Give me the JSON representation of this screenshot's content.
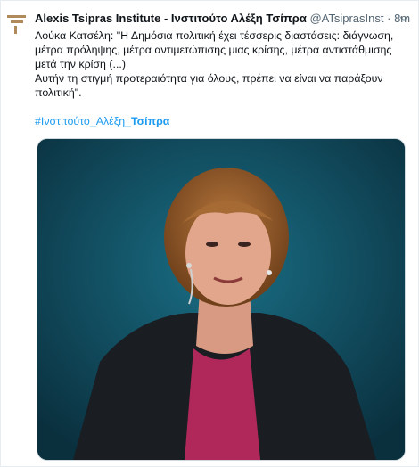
{
  "tweet": {
    "display_name": "Alexis Tsipras Institute - Ινστιτούτο Αλέξη Τσίπρα",
    "handle": "@ATsiprasInst",
    "separator": "·",
    "time": "8m",
    "text_line1": "Λούκα Κατσέλη: \"Η Δημόσια πολιτική έχει τέσσερις διαστάσεις: διάγνωση, μέτρα πρόληψης, μέτρα αντιμετώπισης μιας κρίσης, μέτρα αντιστάθμισης μετά την κρίση (...)",
    "text_line2": "Αυτήν τη στιγμή προτεραιότητα για όλους, πρέπει να είναι να παράξουν πολιτική\".",
    "hashtag_prefix": "#Ινστιτούτο_Αλέξη_",
    "hashtag_bold": "Τσίπρα"
  },
  "icons": {
    "avatar": "institute-logo-icon",
    "more": "chevron-down-icon"
  },
  "colors": {
    "link": "#1d9bf0",
    "secondary_text": "#536471",
    "media_background": "#0c3a4a",
    "logo": "#b08a5a"
  }
}
